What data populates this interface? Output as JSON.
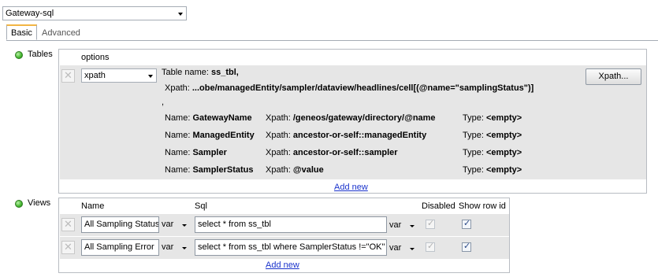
{
  "gateway_select": {
    "value": "Gateway-sql"
  },
  "tabs": [
    {
      "label": "Basic"
    },
    {
      "label": "Advanced"
    }
  ],
  "tables": {
    "label": "Tables",
    "options_header": "options",
    "row": {
      "type_select": "xpath",
      "table_name_prefix": "Table name:",
      "table_name": "ss_tbl,",
      "xpath_prefix": "Xpath:",
      "xpath_value": "...obe/managedEntity/sampler/dataview/headlines/cell[(@name=\"samplingStatus\")]",
      "comma": ",",
      "xpath_button": "Xpath...",
      "columns": [
        {
          "name_label": "Name:",
          "name": "GatewayName",
          "xpath_label": "Xpath:",
          "xpath": "/geneos/gateway/directory/@name",
          "type_label": "Type:",
          "type": "<empty>"
        },
        {
          "name_label": "Name:",
          "name": "ManagedEntity",
          "xpath_label": "Xpath:",
          "xpath": "ancestor-or-self::managedEntity",
          "type_label": "Type:",
          "type": "<empty>"
        },
        {
          "name_label": "Name:",
          "name": "Sampler",
          "xpath_label": "Xpath:",
          "xpath": "ancestor-or-self::sampler",
          "type_label": "Type:",
          "type": "<empty>"
        },
        {
          "name_label": "Name:",
          "name": "SamplerStatus",
          "xpath_label": "Xpath:",
          "xpath": "@value",
          "type_label": "Type:",
          "type": "<empty>"
        }
      ]
    },
    "add_new": "Add new"
  },
  "views": {
    "label": "Views",
    "headers": {
      "name": "Name",
      "sql": "Sql",
      "disabled": "Disabled",
      "show_row_id": "Show row id"
    },
    "rows": [
      {
        "name": "All Sampling Status",
        "name_var": "var",
        "sql": "select * from ss_tbl",
        "sql_var": "var",
        "disabled": true,
        "show_row_id": true
      },
      {
        "name": "All Sampling Error",
        "name_var": "var",
        "sql": "select * from ss_tbl where SamplerStatus !=\"OK\"",
        "sql_var": "var",
        "disabled": true,
        "show_row_id": true
      }
    ],
    "add_new": "Add new"
  },
  "colors": {
    "accent_tab": "#f2b544",
    "link": "#1a33cc",
    "status_dot": "#44b52e",
    "row_bg": "#e6e6e6"
  },
  "icons": {
    "remove": "remove-x-icon",
    "status": "green-dot-icon",
    "dropdown": "chevron-down-icon",
    "check": "checkmark-icon"
  }
}
